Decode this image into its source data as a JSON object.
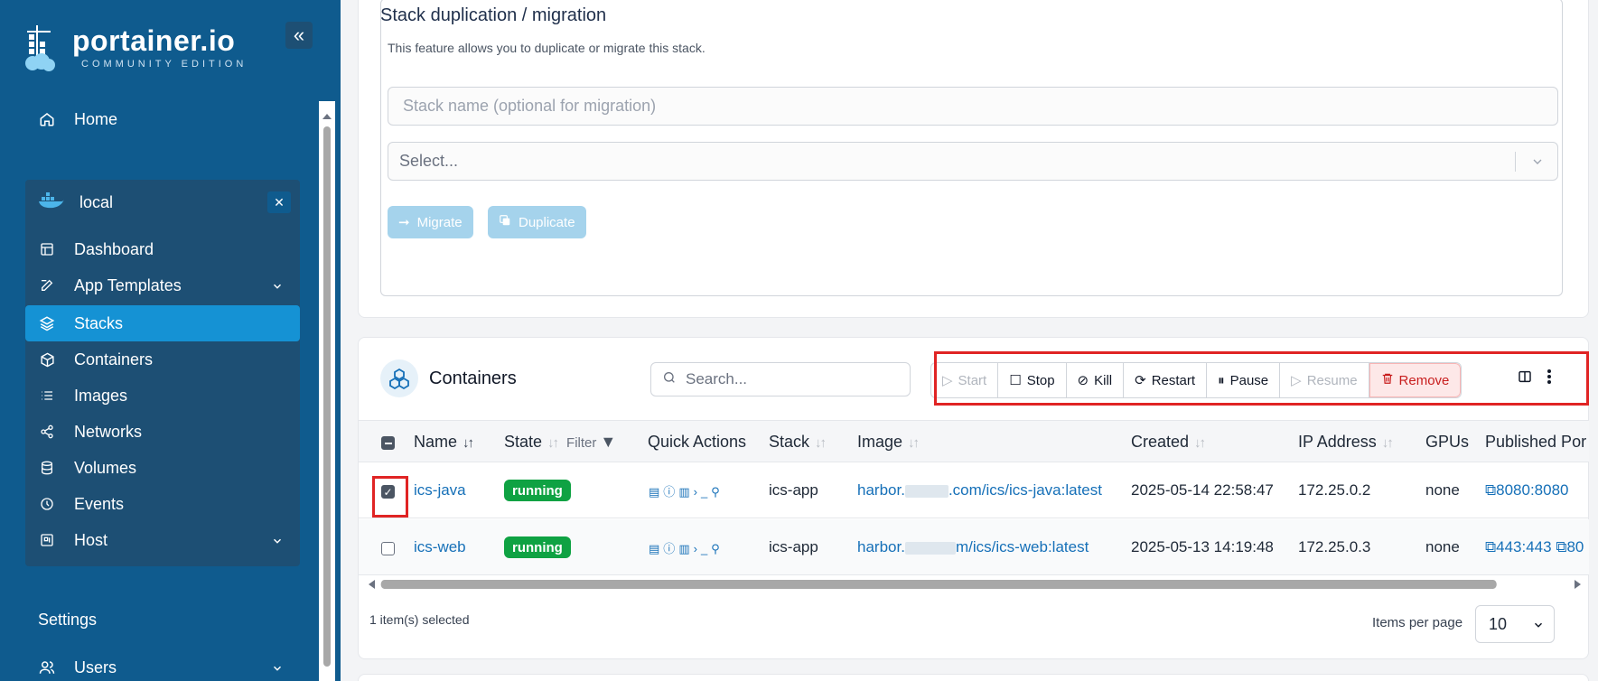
{
  "brand": {
    "name": "portainer.io",
    "edition": "COMMUNITY EDITION"
  },
  "sidebar": {
    "home": "Home",
    "environment": {
      "name": "local"
    },
    "items": [
      {
        "label": "Dashboard",
        "icon": "dashboard-icon"
      },
      {
        "label": "App Templates",
        "icon": "edit-icon"
      },
      {
        "label": "Stacks",
        "icon": "layers-icon",
        "active": true
      },
      {
        "label": "Containers",
        "icon": "box-icon"
      },
      {
        "label": "Images",
        "icon": "list-icon"
      },
      {
        "label": "Networks",
        "icon": "share-icon"
      },
      {
        "label": "Volumes",
        "icon": "database-icon"
      },
      {
        "label": "Events",
        "icon": "clock-icon"
      },
      {
        "label": "Host",
        "icon": "cpu-icon"
      }
    ],
    "settings": "Settings",
    "users": "Users"
  },
  "migration": {
    "title": "Stack duplication / migration",
    "description": "This feature allows you to duplicate or migrate this stack.",
    "name_placeholder": "Stack name (optional for migration)",
    "select_placeholder": "Select...",
    "migrate_label": "Migrate",
    "duplicate_label": "Duplicate"
  },
  "containers": {
    "title": "Containers",
    "search_placeholder": "Search...",
    "actions": {
      "start": "Start",
      "stop": "Stop",
      "kill": "Kill",
      "restart": "Restart",
      "pause": "Pause",
      "resume": "Resume",
      "remove": "Remove"
    },
    "columns": {
      "name": "Name",
      "state": "State",
      "filter": "Filter",
      "quick_actions": "Quick Actions",
      "stack": "Stack",
      "image": "Image",
      "created": "Created",
      "ip": "IP Address",
      "gpus": "GPUs",
      "published": "Published Por"
    },
    "rows": [
      {
        "name": "ics-java",
        "state": "running",
        "stack": "ics-app",
        "image_prefix": "harbor.",
        "image_suffix": ".com/ics/ics-java:latest",
        "created": "2025-05-14 22:58:47",
        "ip": "172.25.0.2",
        "gpus": "none",
        "ports": "8080:8080",
        "selected": true
      },
      {
        "name": "ics-web",
        "state": "running",
        "stack": "ics-app",
        "image_prefix": "harbor.",
        "image_suffix": "m/ics/ics-web:latest",
        "created": "2025-05-13 14:19:48",
        "ip": "172.25.0.3",
        "gpus": "none",
        "ports": "443:443",
        "ports_extra": "80",
        "selected": false
      }
    ],
    "selected_text": "1 item(s) selected",
    "items_per_page_label": "Items per page",
    "items_per_page": "10"
  },
  "colors": {
    "sidebar_bg": "#0f5b8e",
    "active_item": "#1592d4",
    "running": "#0fa243",
    "link": "#1670b8",
    "remove": "#c81e1e",
    "highlight": "#e02424"
  }
}
